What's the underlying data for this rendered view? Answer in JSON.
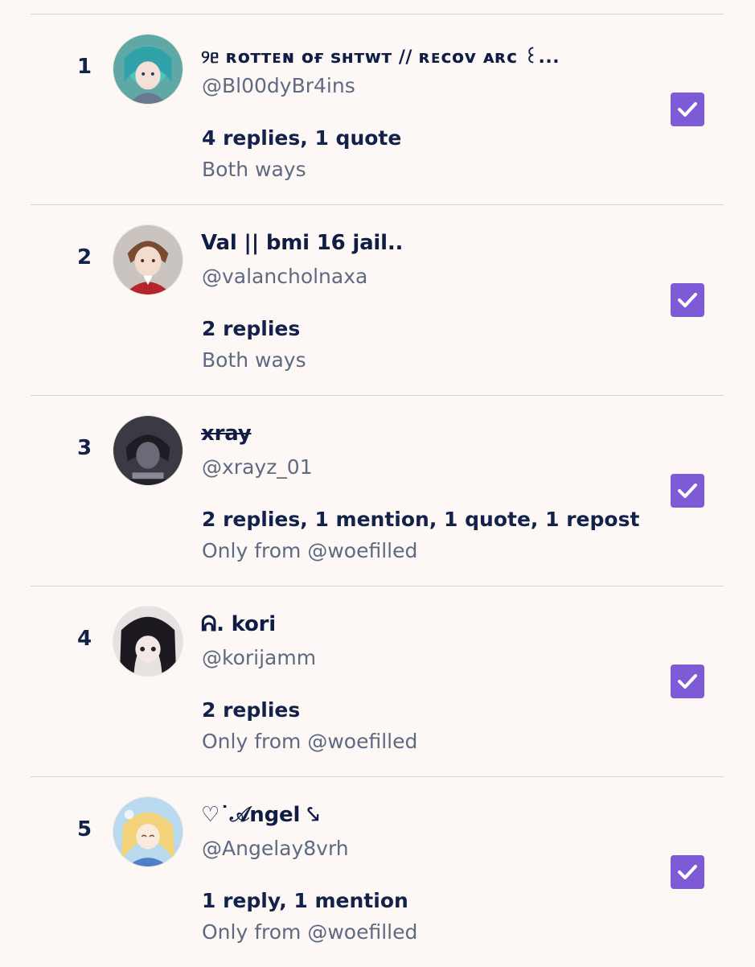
{
  "accent_color": "#7d5bd6",
  "rows": [
    {
      "rank": "1",
      "name": "୨ᥱ ʀᴏᴛᴛᴇɴ ᴏғ sʜᴛᴡᴛ // ʀᴇᴄᴏᴠ ᴀʀᴄ ꒰...",
      "handle": "@Bl00dyBr4ins",
      "activity": "4 replies, 1 quote",
      "direction": "Both ways",
      "checked": true
    },
    {
      "rank": "2",
      "name": "Val || bmi 16 jail..",
      "handle": "@valancholnaxa",
      "activity": "2 replies",
      "direction": "Both ways",
      "checked": true
    },
    {
      "rank": "3",
      "name": "xray",
      "handle": "@xrayz_01",
      "activity": "2 replies, 1 mention, 1 quote, 1 repost",
      "direction": "Only from @woefilled",
      "checked": true
    },
    {
      "rank": "4",
      "name": "ᕱ. kori",
      "handle": "@korijamm",
      "activity": "2 replies",
      "direction": "Only from @woefilled",
      "checked": true
    },
    {
      "rank": "5",
      "name": "♡˙𝒜ngel ⤥",
      "handle": "@Angelay8vrh",
      "activity": "1 reply, 1 mention",
      "direction": "Only from @woefilled",
      "checked": true
    }
  ],
  "icons": {
    "checkbox": "check-icon",
    "avatar": "avatar-image"
  }
}
